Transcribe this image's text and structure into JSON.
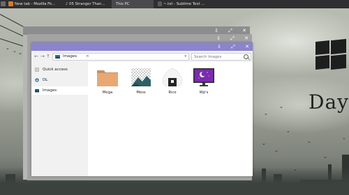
{
  "taskbar": {
    "items": [
      {
        "label": "New tab - Mozilla Fir...",
        "icon": "firefox-icon",
        "active": false
      },
      {
        "label": "05 Stranger Than...",
        "icon": "music-note-icon",
        "active": false
      },
      {
        "label": "This PC",
        "icon": "",
        "active": true
      },
      {
        "label": "~.txt - Sublime Text ...",
        "icon": "sublime-icon",
        "active": false
      }
    ]
  },
  "window_controls": {
    "minimize": "⇩",
    "maximize": "⤢",
    "close": "✕"
  },
  "explorer": {
    "nav": {
      "back": "←",
      "forward": "→",
      "up": "↑"
    },
    "address": {
      "crumb": "Images",
      "separator": ">",
      "dropdown": "▾",
      "refresh": "↻"
    },
    "search": {
      "placeholder": "Search Images"
    },
    "sidebar": [
      {
        "label": "Quick access",
        "icon": "star-icon"
      },
      {
        "label": "DL",
        "icon": "download-icon"
      },
      {
        "label": "Images",
        "icon": "image-icon",
        "selected": true
      }
    ],
    "files": [
      {
        "label": "Mega",
        "icon": "folder-icon"
      },
      {
        "label": "Mess",
        "icon": "mountain-image-icon"
      },
      {
        "label": "Rice",
        "icon": "rice-ball-icon"
      },
      {
        "label": "Wp's",
        "icon": "monitor-wallpaper-icon"
      }
    ]
  },
  "desktop": {
    "widget_text": "Day"
  },
  "colors": {
    "explorer_titlebar": "#8c84cc",
    "taskbar": "#2f2f31",
    "back_window_1": "#b6b6b6",
    "back_window_2": "#a7a7a7"
  }
}
